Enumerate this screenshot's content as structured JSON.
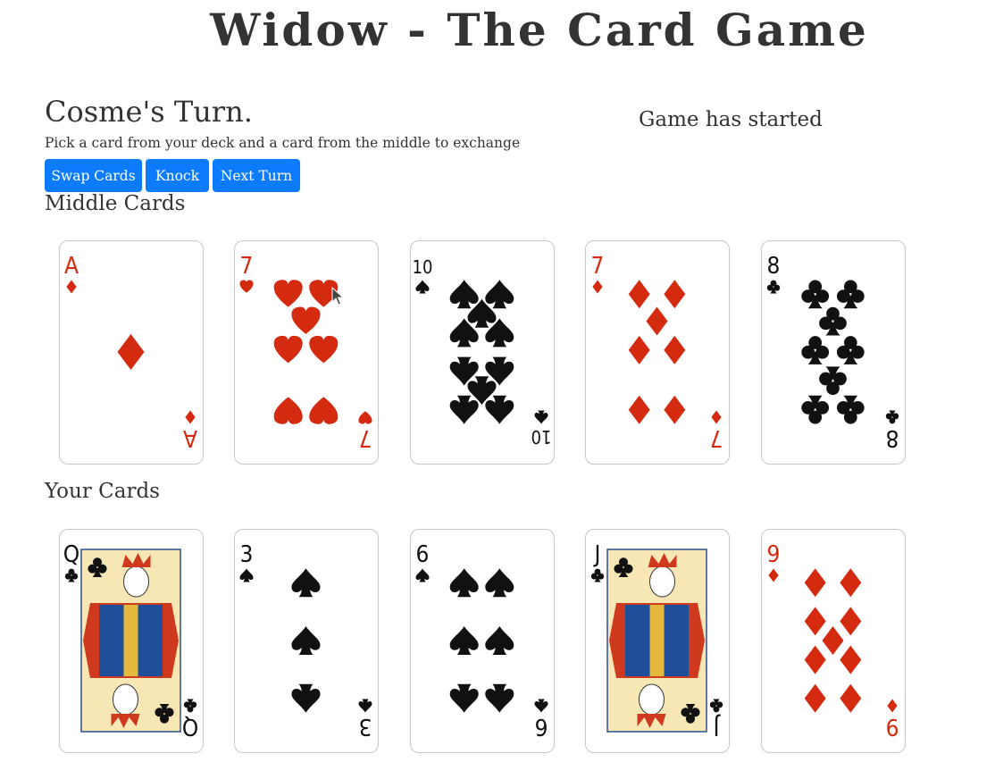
{
  "header": {
    "title": "Widow - The Card Game"
  },
  "turn": {
    "player_turn": "Cosme's Turn.",
    "instruction": "Pick a card from your deck and a card from the middle to exchange"
  },
  "game_status": "Game has started",
  "actions": {
    "swap_label": "Swap Cards",
    "knock_label": "Knock",
    "next_label": "Next Turn"
  },
  "colors": {
    "button": "#0d7bff",
    "red_suit": "#d42a10",
    "black_suit": "#111111"
  },
  "middle": {
    "heading": "Middle Cards",
    "cards": [
      {
        "rank": "A",
        "suit": "diamonds"
      },
      {
        "rank": "7",
        "suit": "hearts"
      },
      {
        "rank": "10",
        "suit": "spades"
      },
      {
        "rank": "7",
        "suit": "diamonds"
      },
      {
        "rank": "8",
        "suit": "clubs"
      }
    ]
  },
  "hand": {
    "heading": "Your Cards",
    "cards": [
      {
        "rank": "Q",
        "suit": "clubs"
      },
      {
        "rank": "3",
        "suit": "spades"
      },
      {
        "rank": "6",
        "suit": "spades"
      },
      {
        "rank": "J",
        "suit": "clubs"
      },
      {
        "rank": "9",
        "suit": "diamonds"
      }
    ]
  }
}
